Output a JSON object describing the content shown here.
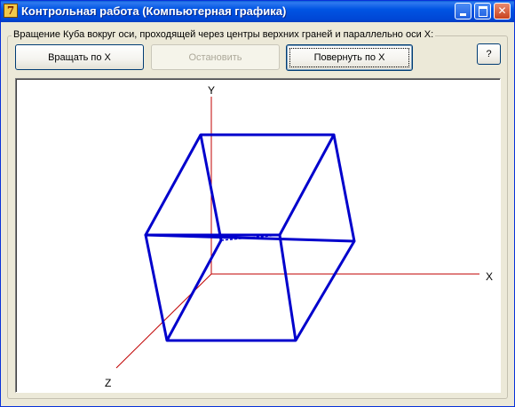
{
  "window": {
    "title": "Контрольная работа (Компьютерная графика)",
    "icon": "app-7-icon"
  },
  "groupbox": {
    "caption": "Вращение Куба вокруг оси, проходящей через центры верхних граней и параллельно оси X:"
  },
  "buttons": {
    "rotate": "Вращать по X",
    "stop": "Остановить",
    "turn": "Повернуть по X",
    "help": "?"
  },
  "scene": {
    "axis_x_label": "X",
    "axis_y_label": "Y",
    "axis_z_label": "Z",
    "axis_color": "#c00000",
    "cube_color": "#0000cc",
    "background": "#ffffff"
  },
  "colors": {
    "titlebar": "#0054e3",
    "window_bg": "#ece9d8"
  }
}
